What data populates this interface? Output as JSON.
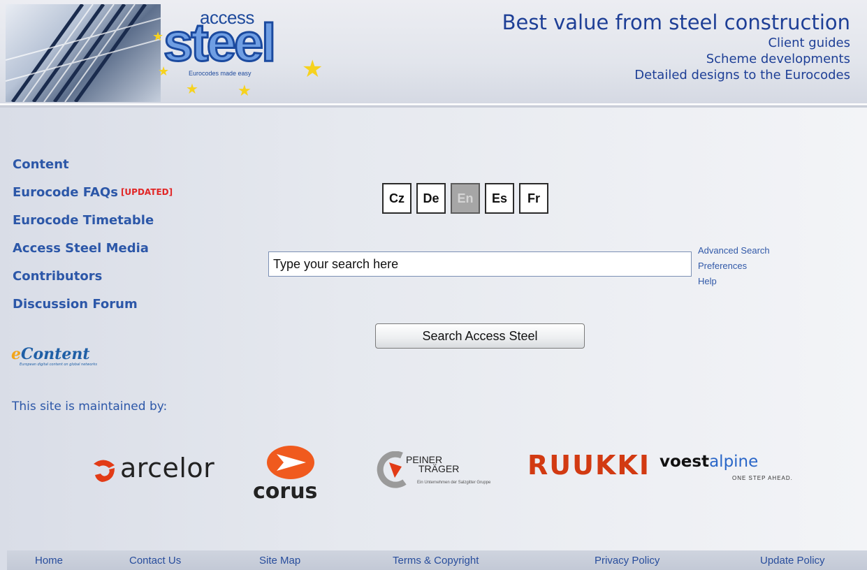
{
  "header": {
    "logo": {
      "top": "access",
      "main": "steel",
      "tagline": "Eurocodes made easy"
    },
    "title": "Best value from steel construction",
    "lines": [
      "Client guides",
      "Scheme developments",
      "Detailed designs to the Eurocodes"
    ]
  },
  "nav": {
    "items": [
      {
        "label": "Content"
      },
      {
        "label": "Eurocode FAQs",
        "badge": "[UPDATED]"
      },
      {
        "label": "Eurocode Timetable"
      },
      {
        "label": "Access Steel Media"
      },
      {
        "label": "Contributors"
      },
      {
        "label": "Discussion Forum"
      }
    ]
  },
  "econtent": {
    "logo_text": "Content",
    "logo_initial": "e",
    "subtitle": "European digital content on global networks"
  },
  "maintained_text": "This site is maintained by:",
  "languages": [
    {
      "code": "Cz",
      "active": false
    },
    {
      "code": "De",
      "active": false
    },
    {
      "code": "En",
      "active": true
    },
    {
      "code": "Es",
      "active": false
    },
    {
      "code": "Fr",
      "active": false
    }
  ],
  "search": {
    "placeholder": "Type your search here",
    "value": "",
    "button_label": "Search Access Steel",
    "links": [
      "Advanced Search",
      "Preferences",
      "Help"
    ]
  },
  "sponsors": {
    "arcelor": "arcelor",
    "corus": "corus",
    "peiner": {
      "line1": "PEINER",
      "line2": "TRÄGER",
      "sub": "Ein Unternehmen der Salzgitter Gruppe"
    },
    "ruukki": "RUUKKI",
    "voestalpine": {
      "bold": "voest",
      "light": "alpine",
      "tagline": "ONE STEP AHEAD."
    }
  },
  "footer": {
    "links": [
      "Home",
      "Contact Us",
      "Site Map",
      "Terms & Copyright",
      "Privacy Policy",
      "Update Policy"
    ]
  },
  "colors": {
    "nav": "#2c57a8",
    "header_text": "#1e3f96",
    "updated": "#e12626",
    "ruukki": "#d23a12",
    "corus": "#f05a1e"
  }
}
